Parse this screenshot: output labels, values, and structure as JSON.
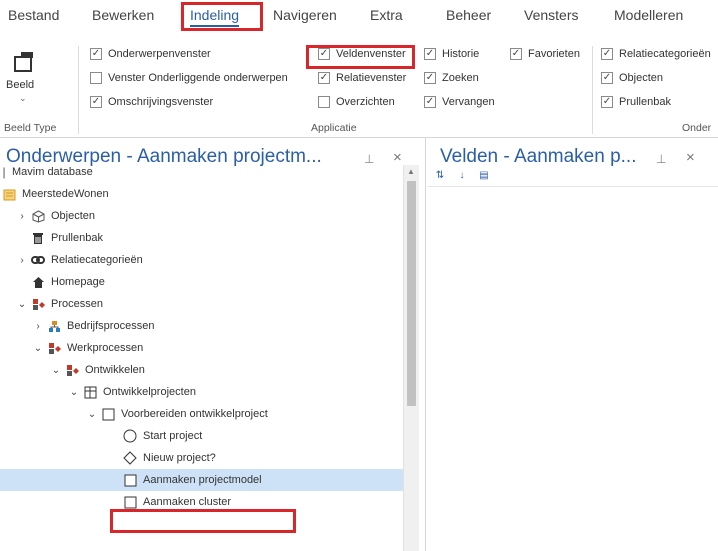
{
  "menu": {
    "tabs": [
      {
        "label": "Bestand"
      },
      {
        "label": "Bewerken"
      },
      {
        "label": "Indeling"
      },
      {
        "label": "Navigeren"
      },
      {
        "label": "Extra"
      },
      {
        "label": "Beheer"
      },
      {
        "label": "Vensters"
      },
      {
        "label": "Modelleren"
      }
    ],
    "active": "Indeling"
  },
  "ribbon": {
    "beeld_label": "Beeld",
    "beeld_type_group": "Beeld Type",
    "applicatie_group": "Applicatie",
    "onder_group": "Onder",
    "checkboxes": [
      {
        "label": "Onderwerpenvenster",
        "checked": true
      },
      {
        "label": "Venster Onderliggende onderwerpen",
        "checked": false
      },
      {
        "label": "Omschrijvingsvenster",
        "checked": true
      },
      {
        "label": "Veldenvenster",
        "checked": true
      },
      {
        "label": "Relatievenster",
        "checked": true
      },
      {
        "label": "Overzichten",
        "checked": false
      },
      {
        "label": "Historie",
        "checked": true
      },
      {
        "label": "Zoeken",
        "checked": true
      },
      {
        "label": "Vervangen",
        "checked": true
      },
      {
        "label": "Favorieten",
        "checked": true
      },
      {
        "label": "Relatiecategorieën",
        "checked": true
      },
      {
        "label": "Objecten",
        "checked": true
      },
      {
        "label": "Prullenbak",
        "checked": true
      }
    ]
  },
  "left_panel": {
    "title": "Onderwerpen - Aanmaken projectm...",
    "tree": [
      {
        "label": "Mavim database",
        "icon": "db-icon"
      },
      {
        "label": "MeerstedeWonen",
        "icon": "folder-icon"
      },
      {
        "label": "Objecten",
        "icon": "cube-icon"
      },
      {
        "label": "Prullenbak",
        "icon": "trash-icon"
      },
      {
        "label": "Relatiecategorieën",
        "icon": "link-icon"
      },
      {
        "label": "Homepage",
        "icon": "home-icon"
      },
      {
        "label": "Processen",
        "icon": "process-icon"
      },
      {
        "label": "Bedrijfsprocessen",
        "icon": "org-icon"
      },
      {
        "label": "Werkprocessen",
        "icon": "process-icon"
      },
      {
        "label": "Ontwikkelen",
        "icon": "process-icon"
      },
      {
        "label": "Ontwikkelprojecten",
        "icon": "grid-icon"
      },
      {
        "label": "Voorbereiden ontwikkelproject",
        "icon": "square-icon"
      },
      {
        "label": "Start project",
        "icon": "circle-icon"
      },
      {
        "label": "Nieuw project?",
        "icon": "diamond-icon"
      },
      {
        "label": "Aanmaken projectmodel",
        "icon": "square-icon"
      },
      {
        "label": "Aanmaken cluster",
        "icon": "square-icon"
      }
    ]
  },
  "right_panel": {
    "title": "Velden - Aanmaken p..."
  },
  "colors": {
    "accent": "#2a5ea8",
    "highlight": "#d9262a",
    "selection": "#cde2f7"
  }
}
